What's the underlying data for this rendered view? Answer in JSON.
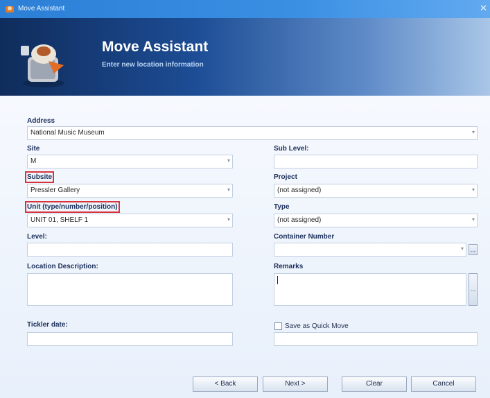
{
  "window": {
    "title": "Move Assistant",
    "close_glyph": "✕"
  },
  "header": {
    "title": "Move Assistant",
    "subtitle": "Enter new location information",
    "icon": "museum-object-icon"
  },
  "form": {
    "address": {
      "label": "Address",
      "value": "National Music Museum"
    },
    "site": {
      "label": "Site",
      "value": "M"
    },
    "sub_level": {
      "label": "Sub Level:",
      "value": ""
    },
    "subsite": {
      "label": "Subsite",
      "value": "Pressler Gallery"
    },
    "project": {
      "label": "Project",
      "value": "(not assigned)"
    },
    "unit": {
      "label": "Unit (type/number/position)",
      "value": "UNIT 01, SHELF 1"
    },
    "type": {
      "label": "Type",
      "value": "(not assigned)"
    },
    "level": {
      "label": "Level:",
      "value": ""
    },
    "container_number": {
      "label": "Container Number",
      "value": "",
      "button": "..."
    },
    "location_description": {
      "label": "Location Description:",
      "value": ""
    },
    "remarks": {
      "label": "Remarks",
      "value": "",
      "button": "..."
    },
    "tickler_date": {
      "label": "Tickler date:",
      "value": ""
    },
    "save_quick_move": {
      "label": "Save as Quick Move",
      "checked": false,
      "value": ""
    }
  },
  "buttons": {
    "back": "< Back",
    "next": "Next >",
    "clear": "Clear",
    "cancel": "Cancel"
  },
  "colors": {
    "highlight": "#d9343e",
    "titlebar": "#2c7fd6",
    "banner": "#1d4d95"
  }
}
